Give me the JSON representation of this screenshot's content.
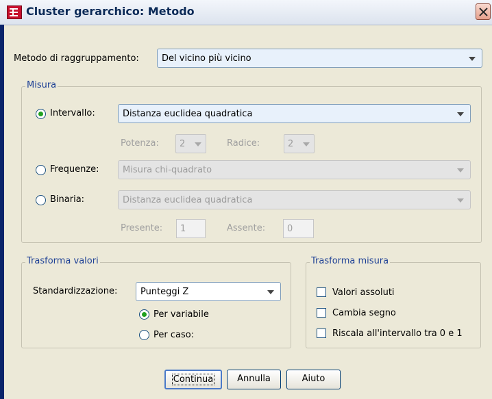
{
  "window": {
    "title": "Cluster gerarchico: Metodo"
  },
  "metodo": {
    "label": "Metodo di raggruppamento:",
    "value": "Del vicino più vicino"
  },
  "misura": {
    "title": "Misura",
    "intervallo": {
      "label": "Intervallo:",
      "value": "Distanza euclidea quadratica",
      "selected": true
    },
    "potenza": {
      "label": "Potenza:",
      "value": "2"
    },
    "radice": {
      "label": "Radice:",
      "value": "2"
    },
    "frequenze": {
      "label": "Frequenze:",
      "value": "Misura chi-quadrato",
      "selected": false
    },
    "binaria": {
      "label": "Binaria:",
      "value": "Distanza euclidea quadratica",
      "selected": false
    },
    "presente": {
      "label": "Presente:",
      "value": "1"
    },
    "assente": {
      "label": "Assente:",
      "value": "0"
    }
  },
  "trasforma_valori": {
    "title": "Trasforma valori",
    "std_label": "Standardizzazione:",
    "std_value": "Punteggi Z",
    "per_variabile": "Per variabile",
    "per_caso": "Per caso:"
  },
  "trasforma_misura": {
    "title": "Trasforma misura",
    "valori_assoluti": "Valori assoluti",
    "cambia_segno": "Cambia segno",
    "riscala": "Riscala all'intervallo tra 0 e 1"
  },
  "buttons": {
    "continua": "Continua",
    "annulla": "Annulla",
    "aiuto": "Aiuto"
  },
  "colors": {
    "accent": "#1C3F95",
    "radio_dot": "#21A121",
    "dialog_bg": "#ECE9D8"
  }
}
